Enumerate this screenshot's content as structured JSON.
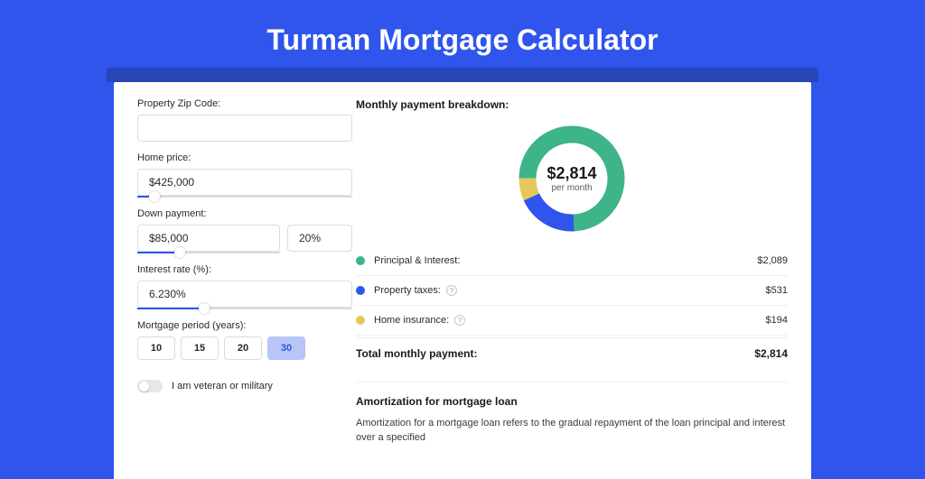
{
  "title": "Turman Mortgage Calculator",
  "colors": {
    "accent": "#2f55ed",
    "green": "#3eb489",
    "blue": "#2f55ed",
    "yellow": "#e7c75a"
  },
  "form": {
    "zip_label": "Property Zip Code:",
    "zip_value": "",
    "home_price_label": "Home price:",
    "home_price_value": "$425,000",
    "down_payment_label": "Down payment:",
    "down_payment_value": "$85,000",
    "down_payment_pct": "20%",
    "interest_label": "Interest rate (%):",
    "interest_value": "6.230%",
    "period_label": "Mortgage period (years):",
    "period_options": [
      "10",
      "15",
      "20",
      "30"
    ],
    "period_selected": "30",
    "veteran_label": "I am veteran or military",
    "slider_home_price_pct": 8,
    "slider_down_payment_pct": 20,
    "slider_interest_pct": 31
  },
  "breakdown": {
    "title": "Monthly payment breakdown:",
    "center_value": "$2,814",
    "center_sub": "per month",
    "items": [
      {
        "label": "Principal & Interest:",
        "amount": "$2,089",
        "color": "#3eb489",
        "info": false
      },
      {
        "label": "Property taxes:",
        "amount": "$531",
        "color": "#2f55ed",
        "info": true
      },
      {
        "label": "Home insurance:",
        "amount": "$194",
        "color": "#e7c75a",
        "info": true
      }
    ],
    "total_label": "Total monthly payment:",
    "total_value": "$2,814"
  },
  "amortization": {
    "title": "Amortization for mortgage loan",
    "body": "Amortization for a mortgage loan refers to the gradual repayment of the loan principal and interest over a specified"
  },
  "chart_data": {
    "type": "pie",
    "title": "Monthly payment breakdown",
    "categories": [
      "Principal & Interest",
      "Property taxes",
      "Home insurance"
    ],
    "values": [
      2089,
      531,
      194
    ],
    "colors": [
      "#3eb489",
      "#2f55ed",
      "#e7c75a"
    ],
    "total": 2814
  }
}
